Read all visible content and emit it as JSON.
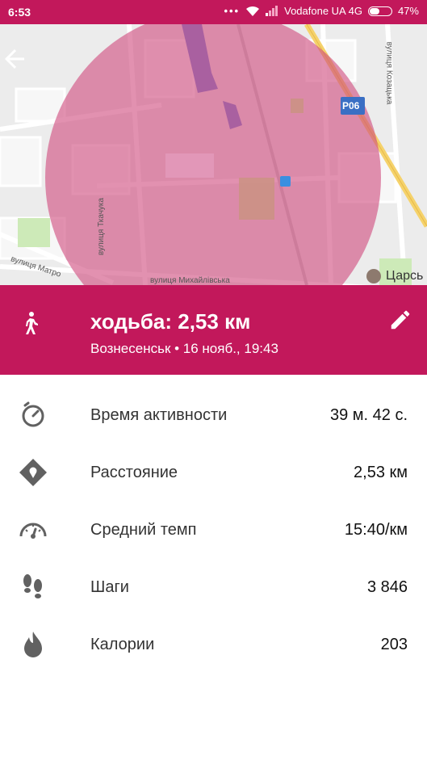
{
  "status_bar": {
    "time": "6:53",
    "carrier": "Vodafone UA 4G",
    "battery": "47%",
    "battery_level": 0.47
  },
  "map": {
    "road_sign": "P06",
    "streets": {
      "kozatska": "вулиця Козацька",
      "tkachuka": "вулиця Ткачука",
      "matrosova": "вулиця Матро",
      "mykhailivska": "вулиця Михайлівська",
      "tsarska": "Царсь"
    },
    "colors": {
      "circle": "#d14d80",
      "header": "#c2185b"
    }
  },
  "activity": {
    "title": "ходьба: 2,53 км",
    "subtitle": "Вознесенськ • 16 нояб., 19:43",
    "type_icon": "walking-icon"
  },
  "stats": [
    {
      "icon": "timer-icon",
      "label": "Время активности",
      "value": "39 м. 42 с."
    },
    {
      "icon": "location-diamond-icon",
      "label": "Расстояние",
      "value": "2,53 км"
    },
    {
      "icon": "speedometer-icon",
      "label": "Средний темп",
      "value": "15:40/км"
    },
    {
      "icon": "footsteps-icon",
      "label": "Шаги",
      "value": "3 846"
    },
    {
      "icon": "flame-icon",
      "label": "Калории",
      "value": "203"
    }
  ]
}
